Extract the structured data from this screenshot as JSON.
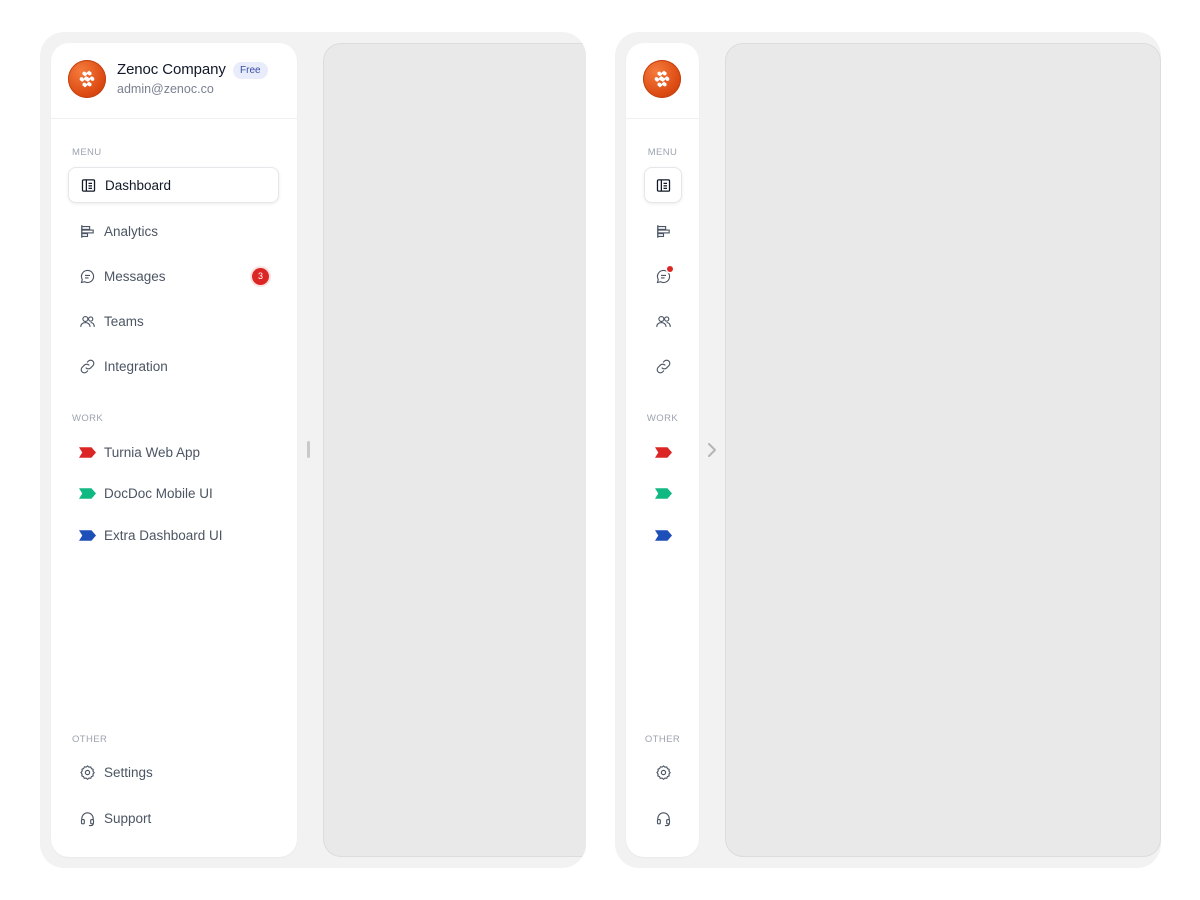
{
  "expanded": {
    "company_name": "Zenoc Company",
    "plan_badge": "Free",
    "email": "admin@zenoc.co",
    "sections": {
      "menu": "MENU",
      "work": "WORK",
      "other": "OTHER"
    },
    "menu_items": [
      {
        "label": "Dashboard",
        "icon": "dashboard-icon",
        "active": true
      },
      {
        "label": "Analytics",
        "icon": "analytics-icon"
      },
      {
        "label": "Messages",
        "icon": "messages-icon",
        "badge": "3"
      },
      {
        "label": "Teams",
        "icon": "teams-icon"
      },
      {
        "label": "Integration",
        "icon": "link-icon"
      }
    ],
    "work_items": [
      {
        "label": "Turnia Web App",
        "color": "#dc2626"
      },
      {
        "label": "DocDoc Mobile UI",
        "color": "#10b981"
      },
      {
        "label": "Extra Dashboard UI",
        "color": "#1e4fb8"
      }
    ],
    "other_items": [
      {
        "label": "Settings",
        "icon": "gear-icon"
      },
      {
        "label": "Support",
        "icon": "headset-icon"
      }
    ]
  },
  "collapsed": {
    "sections": {
      "menu": "MENU",
      "work": "WORK",
      "other": "OTHER"
    }
  },
  "colors": {
    "brand": "#e2561a",
    "badge_red": "#dc2626",
    "tag_red": "#dc2626",
    "tag_green": "#10b981",
    "tag_blue": "#1e4fb8"
  }
}
